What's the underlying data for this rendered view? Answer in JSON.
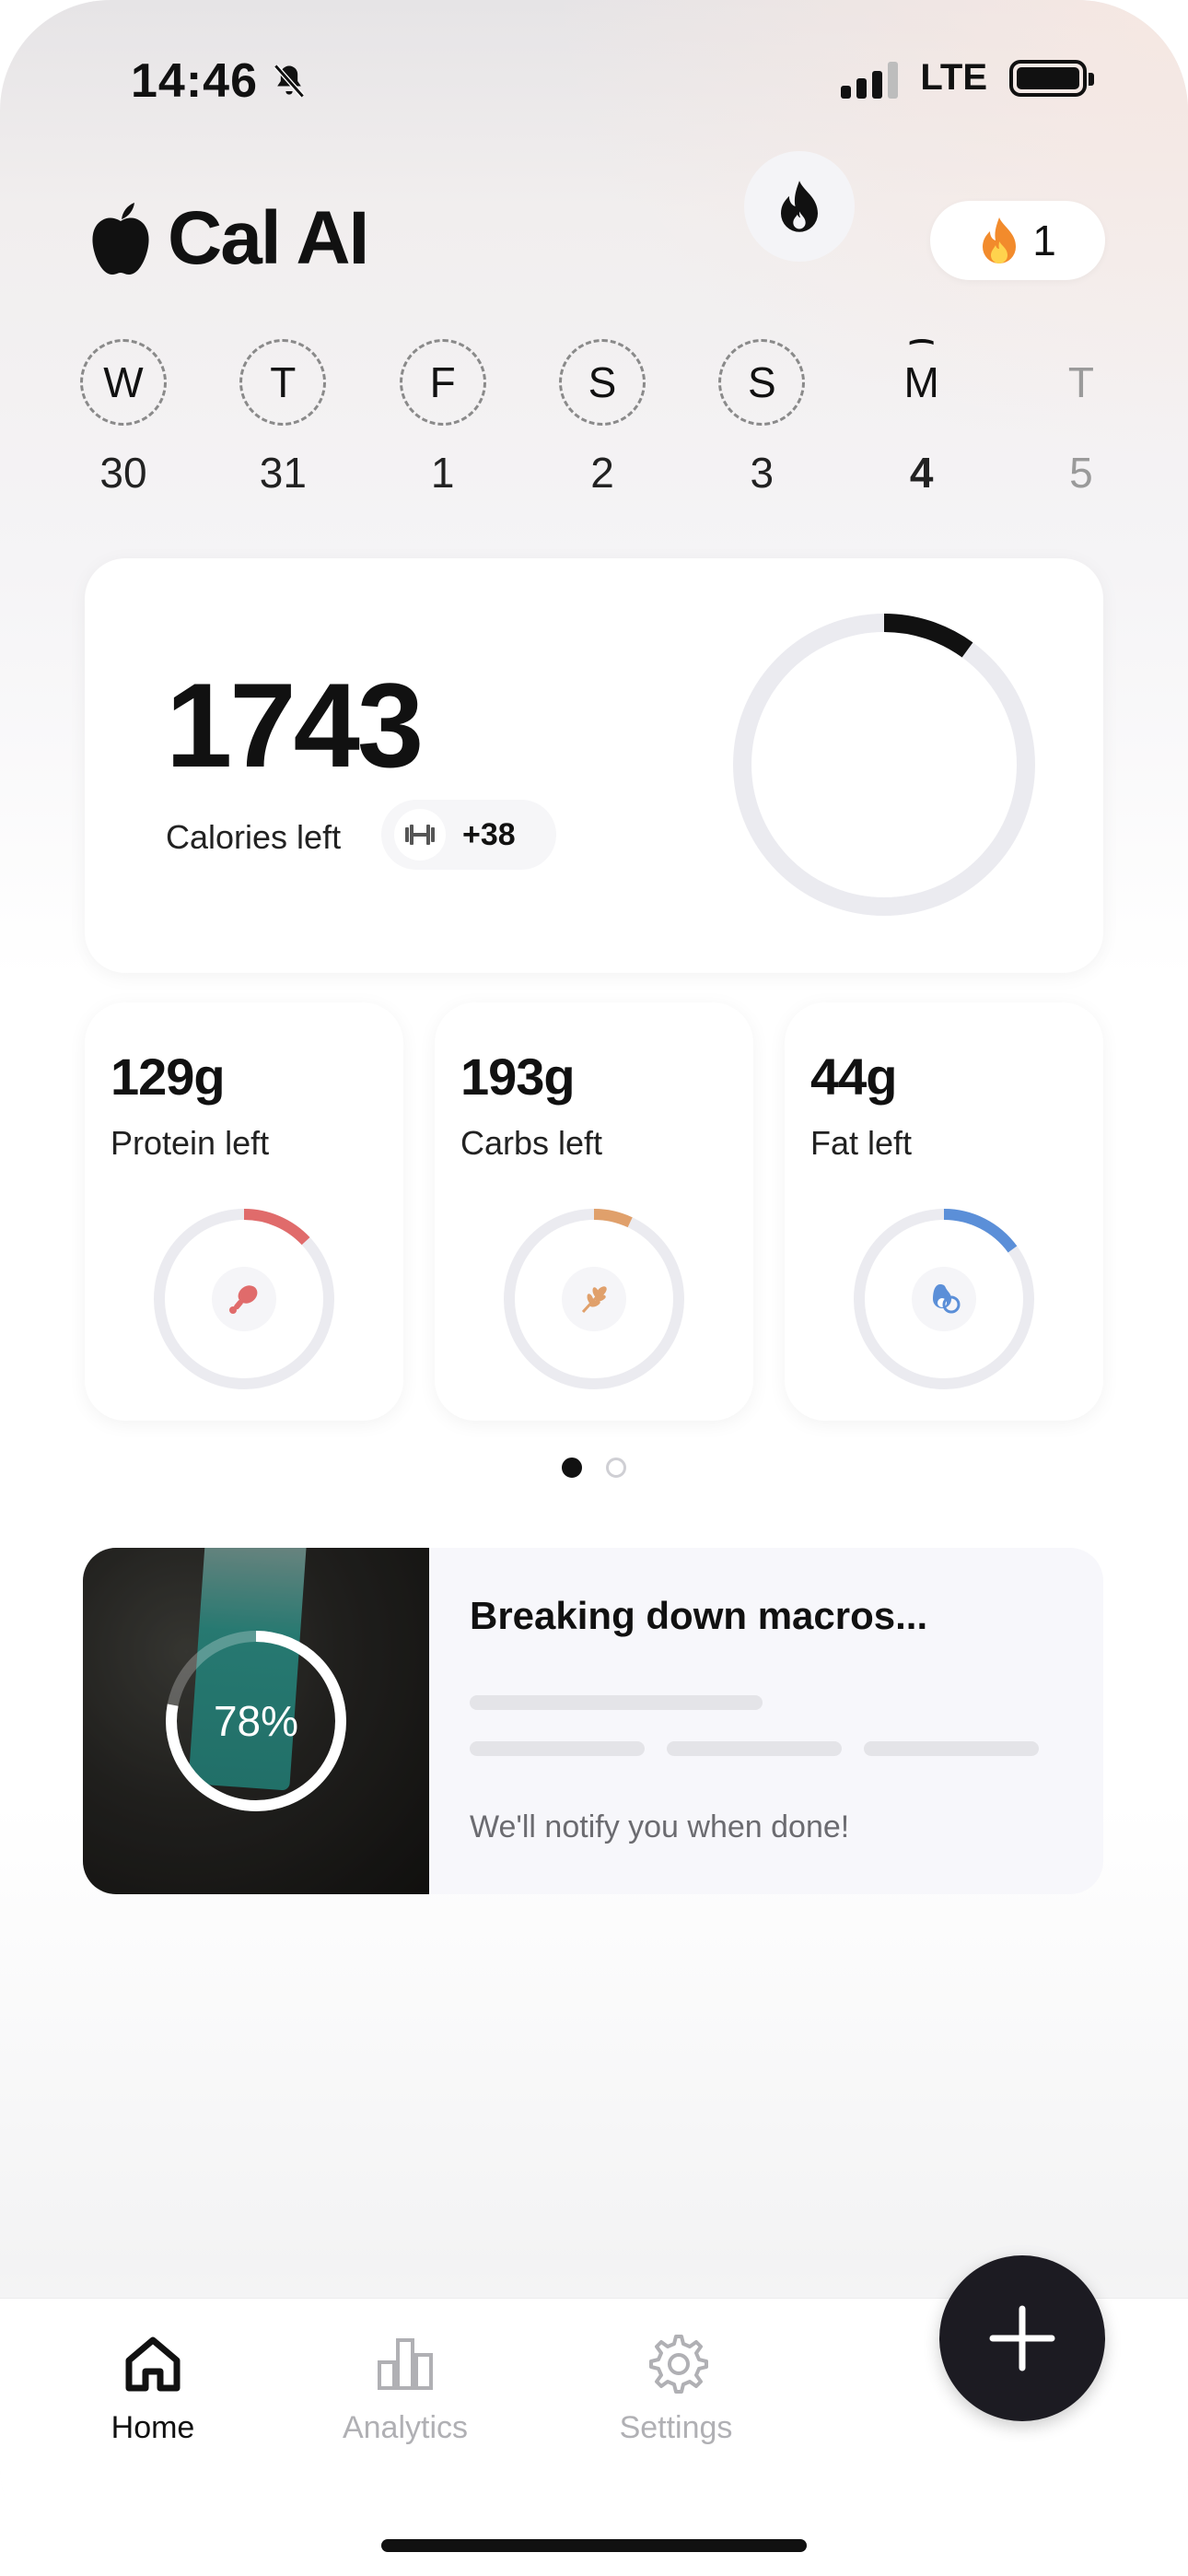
{
  "status": {
    "time": "14:46",
    "network": "LTE"
  },
  "header": {
    "app_name": "Cal AI",
    "streak_count": "1"
  },
  "week": [
    {
      "letter": "W",
      "date": "30",
      "state": "past"
    },
    {
      "letter": "T",
      "date": "31",
      "state": "past"
    },
    {
      "letter": "F",
      "date": "1",
      "state": "past"
    },
    {
      "letter": "S",
      "date": "2",
      "state": "past"
    },
    {
      "letter": "S",
      "date": "3",
      "state": "past"
    },
    {
      "letter": "M",
      "date": "4",
      "state": "today"
    },
    {
      "letter": "T",
      "date": "5",
      "state": "future"
    }
  ],
  "calories": {
    "value": "1743",
    "label": "Calories left",
    "burned": "+38",
    "progress": 0.1
  },
  "macros": [
    {
      "value": "129g",
      "label": "Protein left",
      "color": "#e06b6b",
      "progress": 0.13
    },
    {
      "value": "193g",
      "label": "Carbs left",
      "color": "#e0a06b",
      "progress": 0.07
    },
    {
      "value": "44g",
      "label": "Fat left",
      "color": "#5b8fd8",
      "progress": 0.15
    }
  ],
  "colors": {
    "accent": "#1c1b22",
    "ring_track": "#ebebf0"
  },
  "analysis": {
    "title": "Breaking down macros...",
    "progress_text": "78%",
    "progress": 0.78,
    "note": "We'll notify you when done!"
  },
  "tabs": [
    {
      "label": "Home",
      "icon": "home-icon",
      "active": true
    },
    {
      "label": "Analytics",
      "icon": "bar-chart-icon",
      "active": false
    },
    {
      "label": "Settings",
      "icon": "gear-icon",
      "active": false
    }
  ]
}
